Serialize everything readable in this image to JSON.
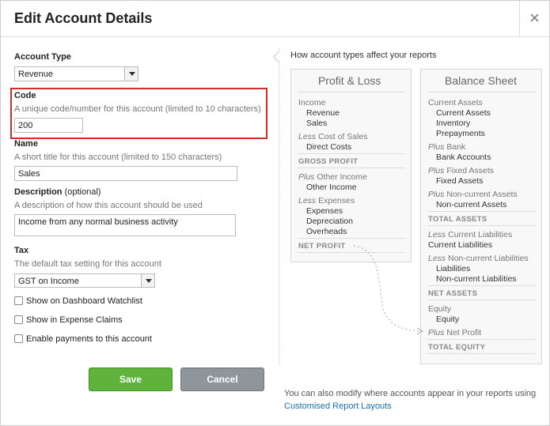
{
  "dialog": {
    "title": "Edit Account Details",
    "close_label": "×"
  },
  "form": {
    "account_type": {
      "label": "Account Type",
      "value": "Revenue"
    },
    "code": {
      "label": "Code",
      "hint": "A unique code/number for this account (limited to 10 characters)",
      "value": "200"
    },
    "name": {
      "label": "Name",
      "hint": "A short title for this account (limited to 150 characters)",
      "value": "Sales"
    },
    "description": {
      "label": "Description",
      "optional": "(optional)",
      "hint": "A description of how this account should be used",
      "value": "Income from any normal business activity"
    },
    "tax": {
      "label": "Tax",
      "hint": "The default tax setting for this account",
      "value": "GST on Income"
    },
    "checkboxes": [
      {
        "label": "Show on Dashboard Watchlist",
        "checked": false
      },
      {
        "label": "Show in Expense Claims",
        "checked": false
      },
      {
        "label": "Enable payments to this account",
        "checked": false
      }
    ],
    "save_label": "Save",
    "cancel_label": "Cancel"
  },
  "info": {
    "title": "How account types affect your reports",
    "pl": {
      "title": "Profit & Loss",
      "income": "Income",
      "revenue": "Revenue",
      "sales": "Sales",
      "less": "Less",
      "cost_of_sales": "Cost of Sales",
      "direct_costs": "Direct Costs",
      "gross_profit": "GROSS PROFIT",
      "plus": "Plus",
      "other_income_head": "Other Income",
      "other_income": "Other Income",
      "less2": "Less",
      "expenses_head": "Expenses",
      "expenses": "Expenses",
      "depreciation": "Depreciation",
      "overheads": "Overheads",
      "net_profit": "NET PROFIT"
    },
    "bs": {
      "title": "Balance Sheet",
      "current_assets_head": "Current Assets",
      "current_assets": "Current Assets",
      "inventory": "Inventory",
      "prepayments": "Prepayments",
      "plus_bank": "Plus",
      "bank_head": "Bank",
      "bank_accounts": "Bank Accounts",
      "plus_fixed": "Plus",
      "fixed_head": "Fixed Assets",
      "fixed_assets": "Fixed Assets",
      "plus_noncurrent": "Plus",
      "noncurrent_head": "Non-current Assets",
      "noncurrent_assets": "Non-current Assets",
      "total_assets": "TOTAL ASSETS",
      "less_cl": "Less",
      "cl_head": "Current Liabilities",
      "current_liabilities": "Current Liabilities",
      "less_ncl": "Less",
      "ncl_head": "Non-current Liabilities",
      "liabilities": "Liabilities",
      "noncurrent_liabilities": "Non-current Liabilities",
      "net_assets": "NET ASSETS",
      "equity_head": "Equity",
      "equity": "Equity",
      "plus_np": "Plus",
      "net_profit": "Net Profit",
      "total_equity": "TOTAL EQUITY"
    },
    "footnote_text": "You can also modify where accounts appear in your reports using ",
    "footnote_link": "Customised Report Layouts"
  }
}
